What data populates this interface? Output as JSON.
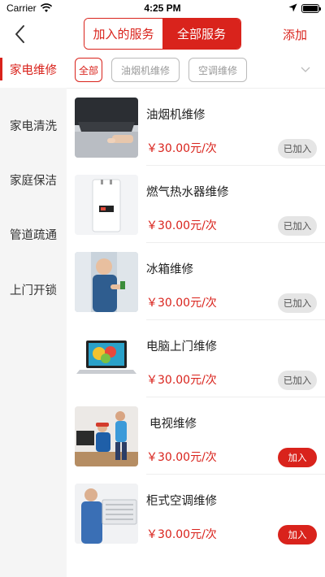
{
  "status_bar": {
    "carrier": "Carrier",
    "time": "4:25 PM"
  },
  "nav": {
    "back_icon": "chevron-left-icon",
    "segments": [
      "加入的服务",
      "全部服务"
    ],
    "active_segment": 1,
    "add_label": "添加"
  },
  "sidebar": {
    "items": [
      {
        "label": "家电维修"
      },
      {
        "label": "家电清洗"
      },
      {
        "label": "家庭保洁"
      },
      {
        "label": "管道疏通"
      },
      {
        "label": "上门开锁"
      }
    ],
    "active_index": 0
  },
  "filters": {
    "chips": [
      "全部",
      "油烟机维修",
      "空调维修"
    ],
    "active_index": 0,
    "expand_icon": "chevron-down-icon"
  },
  "services": [
    {
      "name": "油烟机维修",
      "price": "￥30.00元/次",
      "button": "已加入",
      "added": true,
      "thumb": "range-hood-image"
    },
    {
      "name": "燃气热水器维修",
      "price": "￥30.00元/次",
      "button": "已加入",
      "added": true,
      "thumb": "water-heater-image"
    },
    {
      "name": "冰箱维修",
      "price": "￥30.00元/次",
      "button": "已加入",
      "added": true,
      "thumb": "fridge-repair-image"
    },
    {
      "name": "电脑上门维修",
      "price": "￥30.00元/次",
      "button": "已加入",
      "added": true,
      "thumb": "laptop-image"
    },
    {
      "name": "电视维修",
      "price": "￥30.00元/次",
      "button": "加入",
      "added": false,
      "thumb": "tv-repair-image"
    },
    {
      "name": "柜式空调维修",
      "price": "￥30.00元/次",
      "button": "加入",
      "added": false,
      "thumb": "ac-repair-image"
    }
  ],
  "colors": {
    "accent": "#d9231c",
    "sidebar_bg": "#f5f5f5",
    "added_btn_bg": "#e5e5e5"
  }
}
